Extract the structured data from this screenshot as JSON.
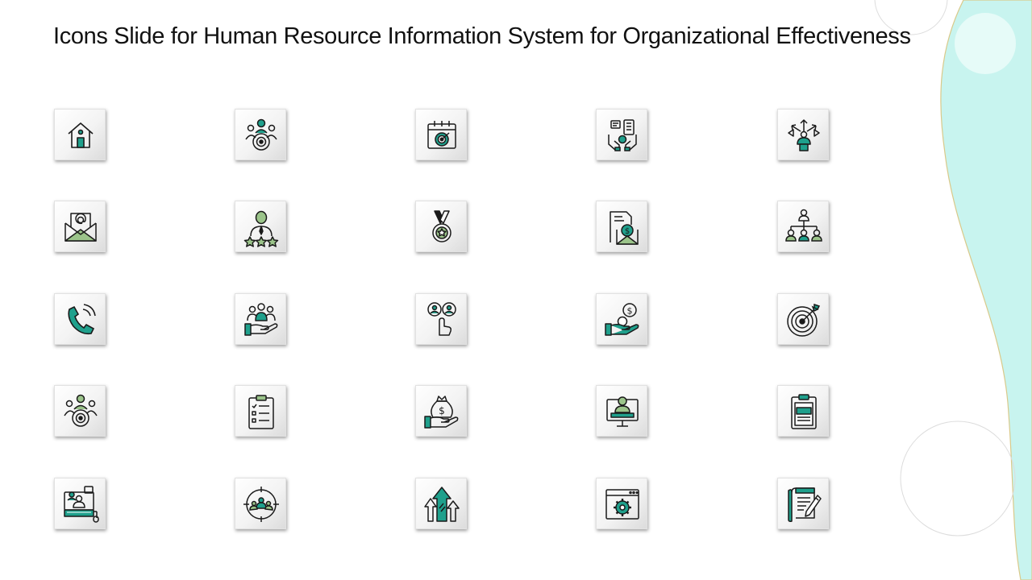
{
  "slide": {
    "title": "Icons Slide for Human Resource Information System for Organizational Effectiveness"
  },
  "colors": {
    "accent_teal": "#1fa08c",
    "accent_green": "#9bc48a",
    "panel_aqua": "#c8f4ef",
    "outline": "#1a1a1a"
  },
  "icons": [
    [
      "home-icon",
      "team-target-icon",
      "calendar-target-icon",
      "hands-tablet-icon",
      "arrows-person-icon"
    ],
    [
      "email-envelope-icon",
      "employee-rating-icon",
      "medal-icon",
      "document-payment-icon",
      "org-chart-icon"
    ],
    [
      "phone-call-icon",
      "hand-team-icon",
      "select-person-icon",
      "hand-dollar-icon",
      "target-icon"
    ],
    [
      "team-target-icon",
      "checklist-clipboard-icon",
      "money-bag-hand-icon",
      "monitor-profile-icon",
      "clipboard-document-icon"
    ],
    [
      "online-meeting-icon",
      "focus-team-icon",
      "growth-arrows-icon",
      "browser-settings-icon",
      "document-pen-icon"
    ]
  ]
}
